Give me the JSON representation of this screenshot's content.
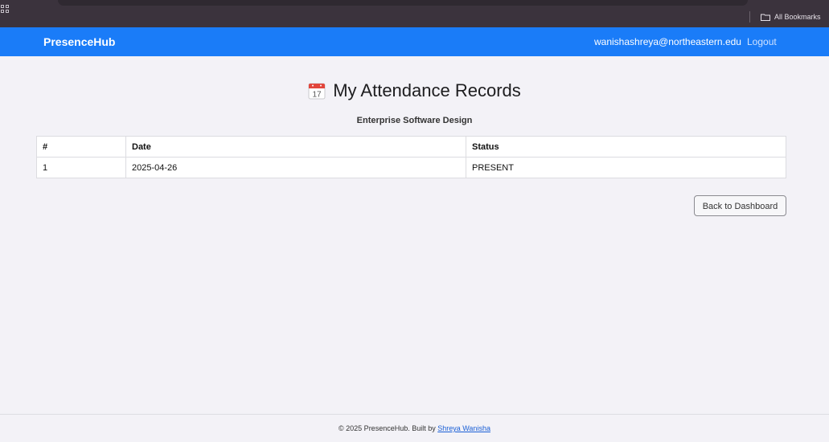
{
  "browser": {
    "bookmarks_label": "All Bookmarks"
  },
  "navbar": {
    "brand": "PresenceHub",
    "user_email": "wanishashreya@northeastern.edu",
    "logout_label": "Logout",
    "color": "#1a7cf8"
  },
  "main": {
    "title": "My Attendance Records",
    "title_icon": "calendar-icon",
    "course": "Enterprise Software Design",
    "table": {
      "headers": [
        "#",
        "Date",
        "Status"
      ],
      "rows": [
        [
          "1",
          "2025-04-26",
          "PRESENT"
        ]
      ]
    },
    "back_button_label": "Back to Dashboard"
  },
  "footer": {
    "text": "© 2025 PresenceHub. Built by",
    "author_link": "Shreya Wanisha"
  }
}
